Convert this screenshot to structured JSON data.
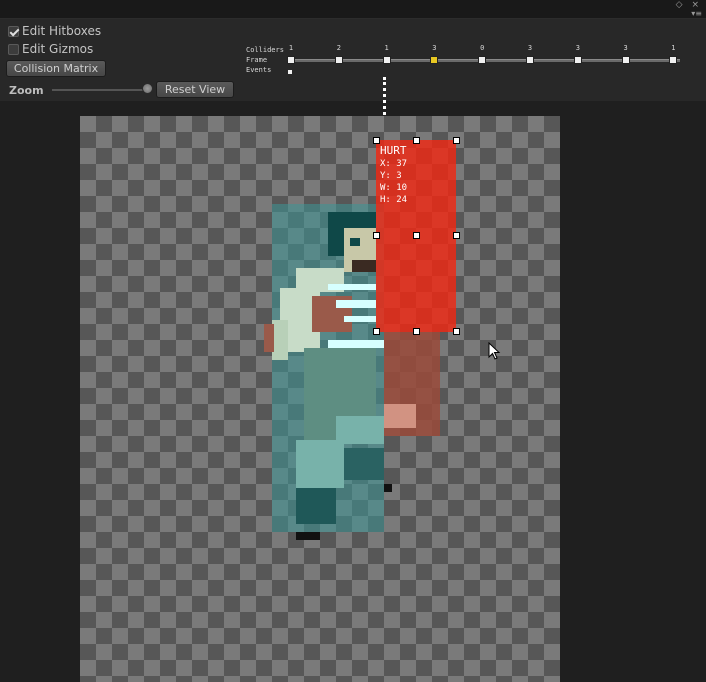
{
  "header": {
    "window_controls": "◇ ×",
    "menu_glyph": "▾≡"
  },
  "toolbar": {
    "edit_hitboxes": {
      "label": "Edit Hitboxes",
      "checked": true
    },
    "edit_gizmos": {
      "label": "Edit Gizmos",
      "checked": false
    },
    "collision_matrix_label": "Collision Matrix",
    "zoom_label": "Zoom",
    "zoom_value": 0.9,
    "reset_view_label": "Reset View"
  },
  "timeline": {
    "row_labels": {
      "colliders": "Colliders",
      "frame": "Frame",
      "events": "Events"
    },
    "collider_counts": [
      "1",
      "2",
      "1",
      "3",
      "0",
      "3",
      "3",
      "3",
      "1"
    ],
    "selected_frame": 3,
    "event_frames": [
      1
    ]
  },
  "hitbox": {
    "title": "HURT",
    "x_text": "X: 37",
    "y_text": "Y: 3",
    "w_text": "W: 10",
    "h_text": "H: 24",
    "color": "#f02814"
  },
  "colors": {
    "accent_selected_key": "#e8c822",
    "body_box": "#3c9696"
  }
}
